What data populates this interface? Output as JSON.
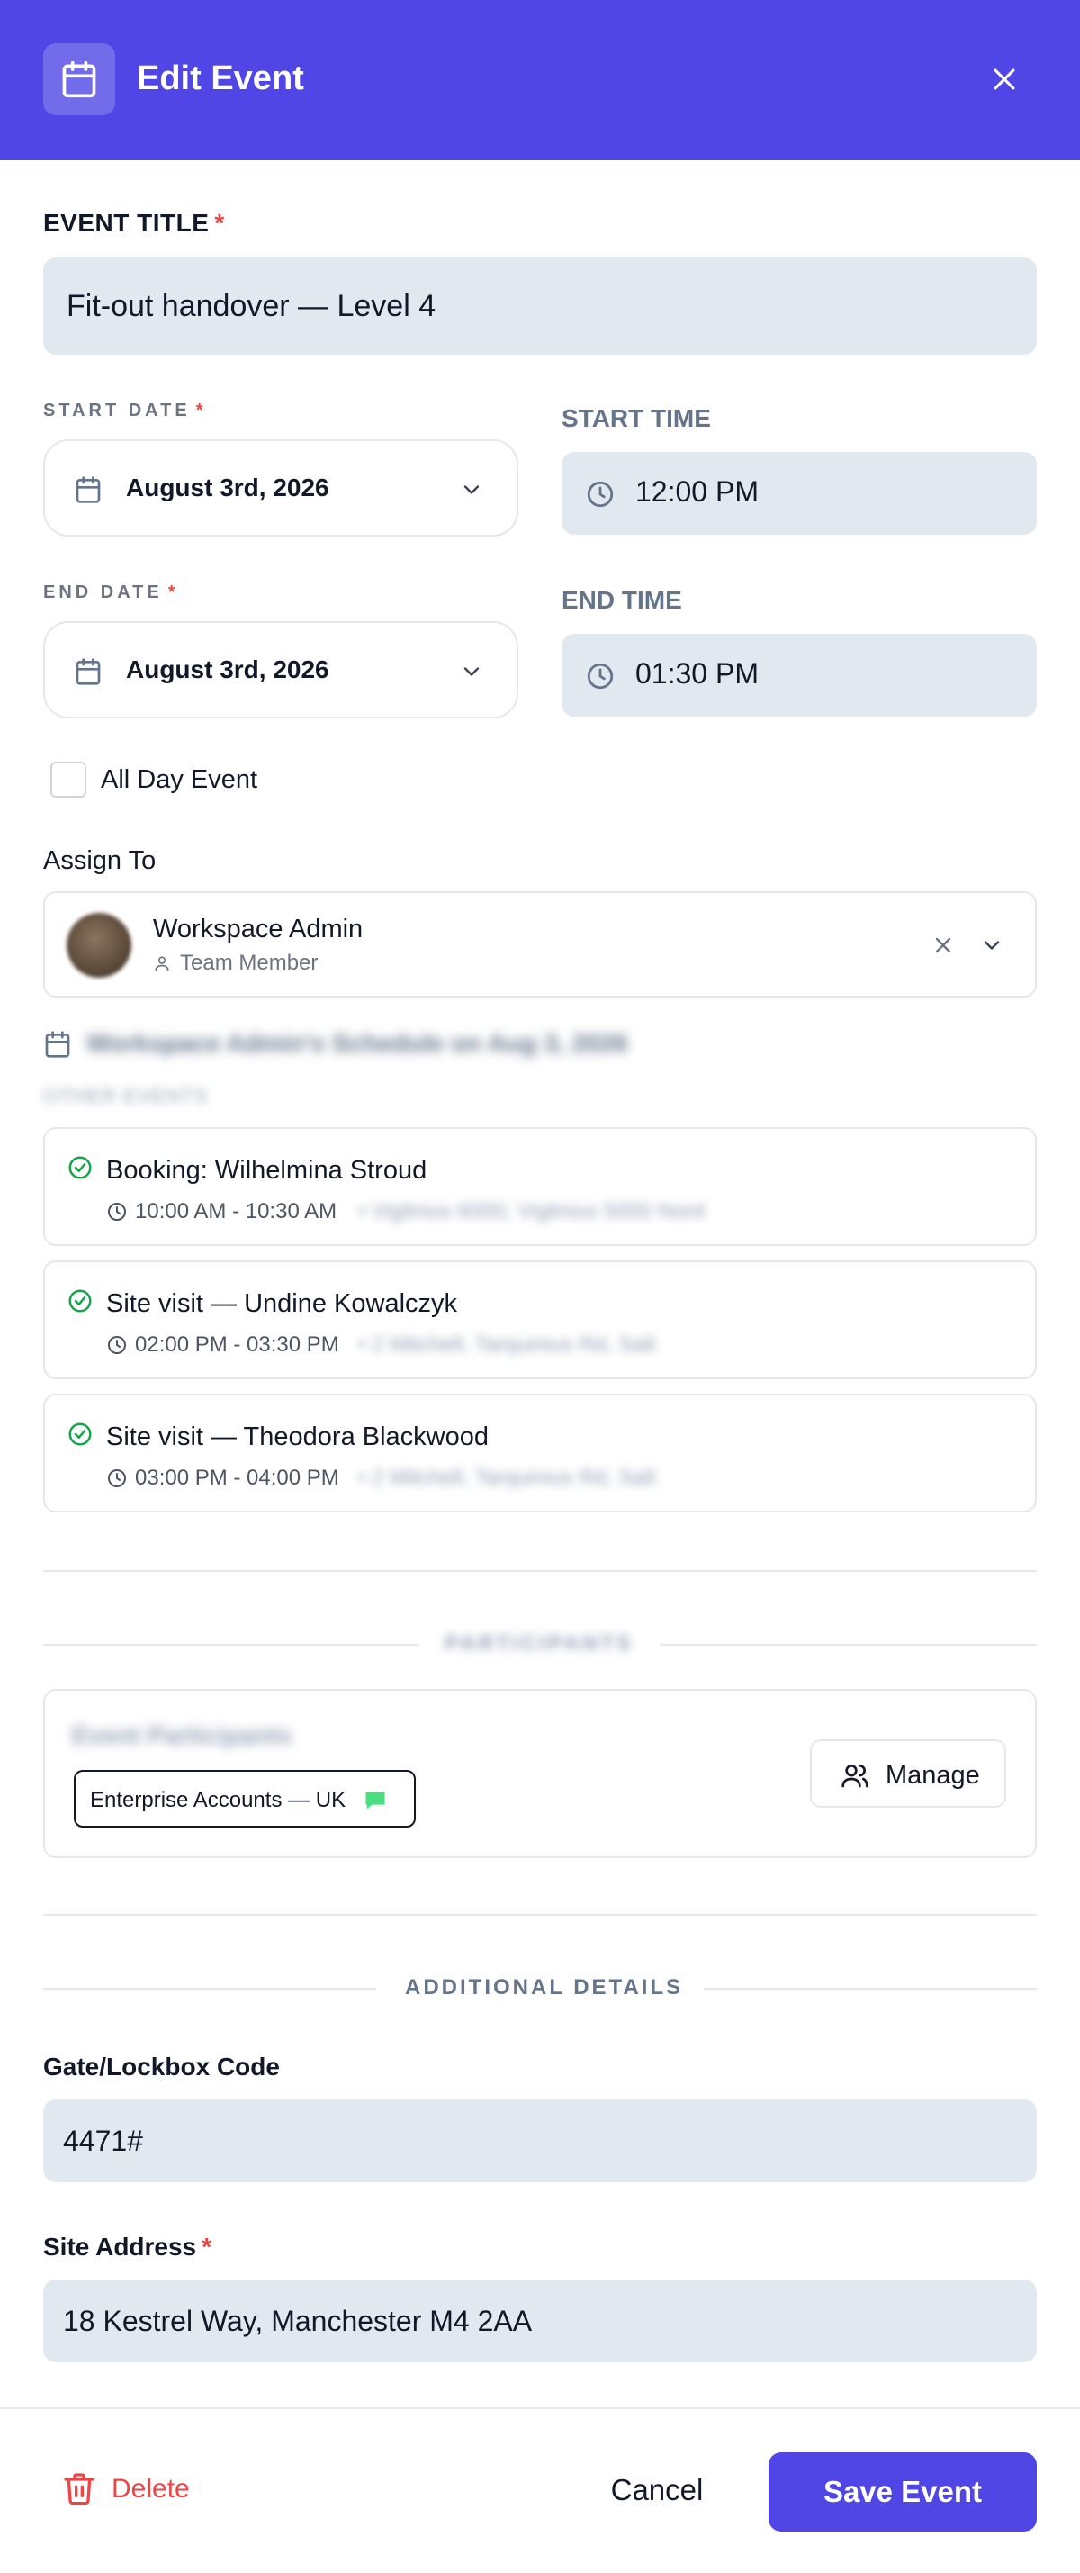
{
  "header": {
    "title": "Edit Event",
    "icon": "calendar-icon",
    "close_icon": "close-icon"
  },
  "event_title": {
    "label": "EVENT TITLE",
    "required_mark": "*",
    "value": "Fit-out handover — Level 4"
  },
  "start_date": {
    "label": "START DATE",
    "required_mark": "*",
    "value": "August 3rd, 2026"
  },
  "start_time": {
    "label": "START TIME",
    "value": "12:00 PM"
  },
  "end_date": {
    "label": "END DATE",
    "required_mark": "*",
    "value": "August 3rd, 2026"
  },
  "end_time": {
    "label": "END TIME",
    "value": "01:30 PM"
  },
  "all_day": {
    "label": "All Day Event",
    "checked": false
  },
  "assign": {
    "label": "Assign To",
    "name": "Workspace Admin",
    "role": "Team Member"
  },
  "schedule": {
    "title": "Workspace Admin's Schedule on Aug 3, 2026",
    "subtitle": "OTHER EVENTS",
    "events": [
      {
        "title": "Booking: Wilhelmina Stroud",
        "time": "10:00 AM - 10:30 AM",
        "extra": "• Viglinius 6000, Viglinius 5000 Nord"
      },
      {
        "title": "Site visit — Undine Kowalczyk",
        "time": "02:00 PM - 03:30 PM",
        "extra": "• 2 Mitchell, Tarquinius Rd, Salt"
      },
      {
        "title": "Site visit — Theodora Blackwood",
        "time": "03:00 PM - 04:00 PM",
        "extra": "• 2 Mitchell, Tarquinius Rd, Salt"
      }
    ]
  },
  "participants": {
    "section_label": "PARTICIPANTS",
    "box_title": "Event Participants",
    "chip": "Enterprise Accounts — UK",
    "manage_label": "Manage"
  },
  "additional": {
    "section_label": "ADDITIONAL DETAILS",
    "gate_label": "Gate/Lockbox Code",
    "gate_value": "4471#",
    "address_label": "Site Address",
    "address_required": "*",
    "address_value": "18 Kestrel Way, Manchester M4 2AA"
  },
  "footer": {
    "delete_label": "Delete",
    "cancel_label": "Cancel",
    "save_label": "Save Event"
  },
  "colors": {
    "brand": "#4f46e5",
    "danger": "#ef4444",
    "success": "#16a34a",
    "chip_icon": "#4ade80",
    "input_bg": "#e2e8f0"
  }
}
